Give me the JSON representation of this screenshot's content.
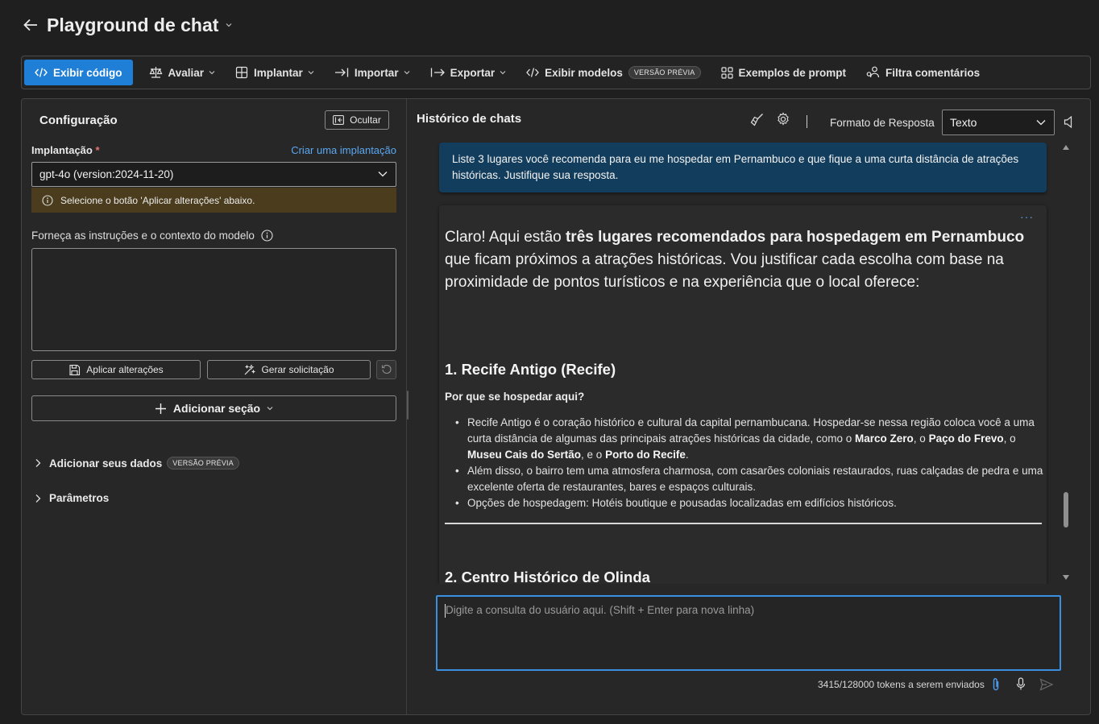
{
  "header": {
    "title": "Playground de chat"
  },
  "toolbar": {
    "view_code": "Exibir código",
    "evaluate": "Avaliar",
    "deploy": "Implantar",
    "import": "Importar",
    "export": "Exportar",
    "view_models": "Exibir modelos",
    "preview_badge": "VERSÃO PRÉVIA",
    "prompt_samples": "Exemplos de prompt",
    "filter_comments": "Filtra comentários"
  },
  "config": {
    "title": "Configuração",
    "hide_button": "Ocultar",
    "deployment_label": "Implantação",
    "required_mark": "*",
    "create_link": "Criar uma implantação",
    "deployment_value": "gpt-4o (version:2024-11-20)",
    "warning": "Selecione o botão 'Aplicar alterações' abaixo.",
    "instructions_label": "Forneça as instruções e o contexto do modelo",
    "instructions_value": "",
    "apply_button": "Aplicar alterações",
    "generate_button": "Gerar solicitação",
    "add_section": "Adicionar seção",
    "add_data": "Adicionar seus dados",
    "add_data_badge": "VERSÃO PRÉVIA",
    "parameters": "Parâmetros"
  },
  "chat": {
    "title": "Histórico de chats",
    "response_format_label": "Formato de Resposta",
    "response_format_value": "Texto",
    "user_message": "Liste 3 lugares você recomenda para eu me hospedar em Pernambuco e que fique a uma curta distância de atrações históricas. Justifique sua resposta.",
    "more": "···",
    "intro_1": "Claro! Aqui estão ",
    "intro_bold": "três lugares recomendados para hospedagem em Pernambuco",
    "intro_2": " que ficam próximos a atrações históricas. Vou justificar cada escolha com base na proximidade de pontos turísticos e na experiência que o local oferece:",
    "heading_1": "1. Recife Antigo (Recife)",
    "why_label": "Por que se hospedar aqui?",
    "b1_text": "Recife Antigo é o coração histórico e cultural da capital pernambucana. Hospedar-se nessa região coloca você a uma curta distância de algumas das principais atrações históricas da cidade, como o ",
    "b1_marco": "Marco Zero",
    "b1_sep1": ", o ",
    "b1_paco": "Paço do Frevo",
    "b1_sep2": ", o ",
    "b1_museu": "Museu Cais do Sertão",
    "b1_sep3": ", e o ",
    "b1_porto": "Porto do Recife",
    "b1_end": ".",
    "b2": "Além disso, o bairro tem uma atmosfera charmosa, com casarões coloniais restaurados, ruas calçadas de pedra e uma excelente oferta de restaurantes, bares e espaços culturais.",
    "b3": "Opções de hospedagem: Hotéis boutique e pousadas localizadas em edifícios históricos.",
    "heading_2": "2. Centro Histórico de Olinda",
    "query_placeholder": "Digite a consulta do usuário aqui. (Shift + Enter para nova linha)",
    "query_value": "",
    "tokens": "3415/128000 tokens a serem enviados"
  },
  "colors": {
    "accent": "#1f7fd6",
    "link": "#5aa7f0",
    "user_bubble": "#133d5c",
    "warning_bg": "#4a3c1d",
    "focus_border": "#3b8fe0"
  }
}
